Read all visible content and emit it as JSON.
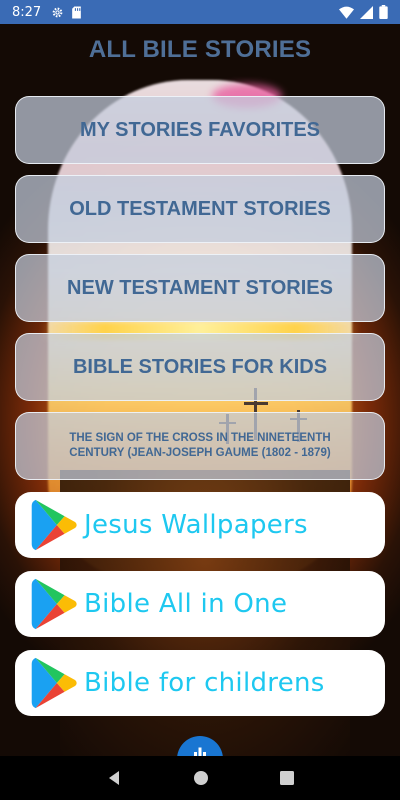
{
  "status_bar": {
    "time": "8:27",
    "icons": [
      "settings-icon",
      "sd-card-icon",
      "wifi-icon",
      "signal-icon",
      "battery-icon"
    ]
  },
  "title": "ALL BILE STORIES",
  "story_buttons": [
    {
      "label": "MY STORIES FAVORITES"
    },
    {
      "label": "OLD TESTAMENT STORIES"
    },
    {
      "label": "NEW TESTAMENT STORIES"
    },
    {
      "label": "BIBLE STORIES FOR KIDS"
    },
    {
      "label": "THE SIGN OF THE CROSS IN THE NINETEENTH CENTURY (JEAN-JOSEPH GAUME (1802 - 1879)"
    }
  ],
  "app_buttons": [
    {
      "label": "Jesus Wallpapers",
      "icon": "google-play-icon"
    },
    {
      "label": "Bible All in One",
      "icon": "google-play-icon"
    },
    {
      "label": "Bible for childrens",
      "icon": "google-play-icon"
    }
  ],
  "nav_bar": {
    "icons": [
      "back-icon",
      "home-icon",
      "recents-icon"
    ]
  },
  "colors": {
    "status_bar": "#3a6bb5",
    "title_text": "#4f6f97",
    "story_text": "#416894",
    "app_text": "#1ec8f0",
    "fab": "#1976d2"
  }
}
